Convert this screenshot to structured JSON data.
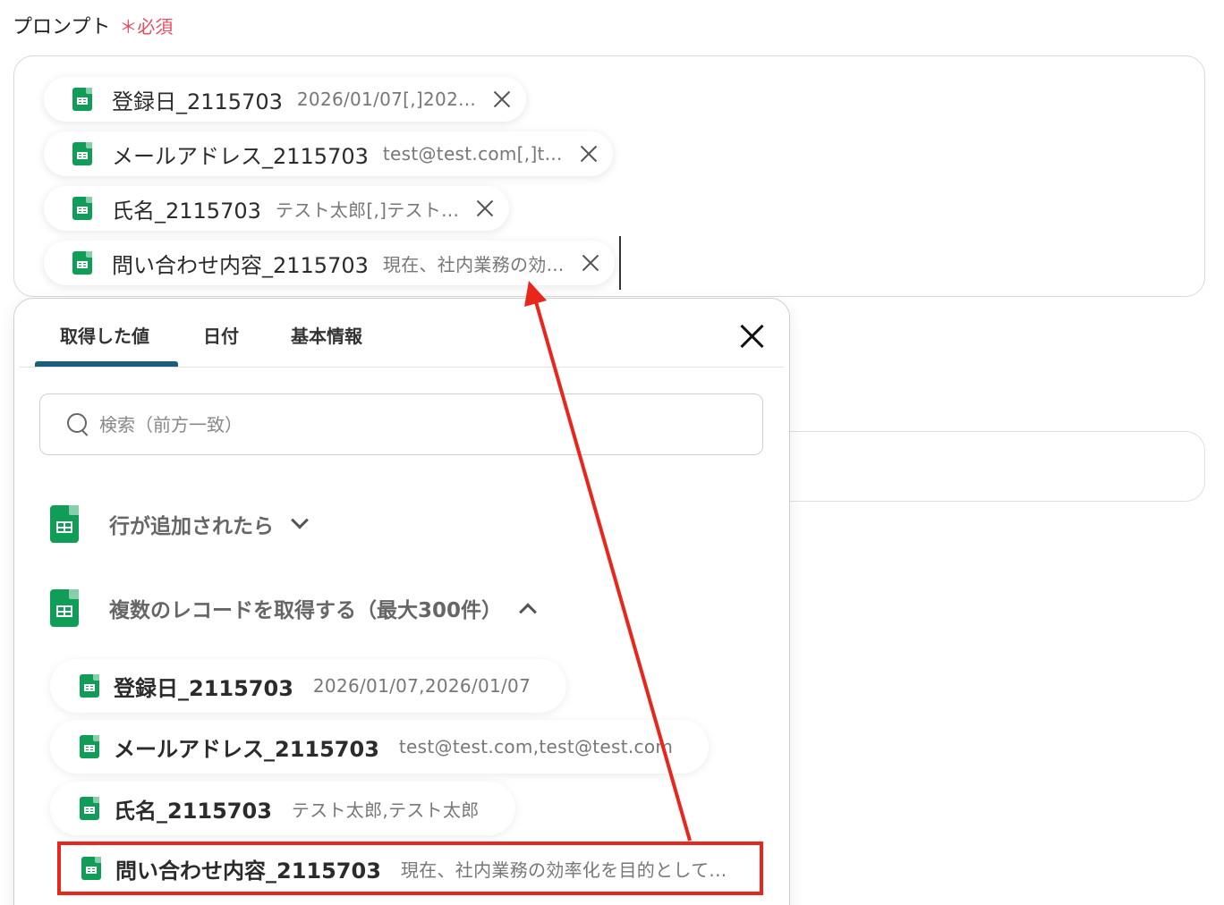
{
  "field": {
    "label": "プロンプト",
    "required": "＊必須"
  },
  "chips": [
    {
      "name": "登録日_2115703",
      "value": "2026/01/07[,]202..."
    },
    {
      "name": "メールアドレス_2115703",
      "value": "test@test.com[,]t..."
    },
    {
      "name": "氏名_2115703",
      "value": "テスト太郎[,]テスト..."
    },
    {
      "name": "問い合わせ内容_2115703",
      "value": "現在、社内業務の効..."
    }
  ],
  "panel": {
    "tabs": [
      "取得した値",
      "日付",
      "基本情報"
    ],
    "active_tab": "取得した値",
    "search_placeholder": "検索（前方一致）",
    "sections": [
      {
        "title": "行が追加されたら",
        "expanded": false
      },
      {
        "title": "複数のレコードを取得する（最大300件）",
        "expanded": true
      }
    ],
    "items": [
      {
        "name": "登録日_2115703",
        "value": "2026/01/07,2026/01/07"
      },
      {
        "name": "メールアドレス_2115703",
        "value": "test@test.com,test@test.com"
      },
      {
        "name": "氏名_2115703",
        "value": "テスト太郎,テスト太郎"
      },
      {
        "name": "問い合わせ内容_2115703",
        "value": "現在、社内業務の効率化を目的として..."
      }
    ]
  },
  "colors": {
    "accent": "#1b5e7a",
    "required": "#e84d5f",
    "annotation": "#e8261b",
    "sheet_green": "#0f9d58"
  },
  "icons": {
    "sheet": "google-sheets-icon",
    "close": "close-icon",
    "search": "search-icon"
  }
}
